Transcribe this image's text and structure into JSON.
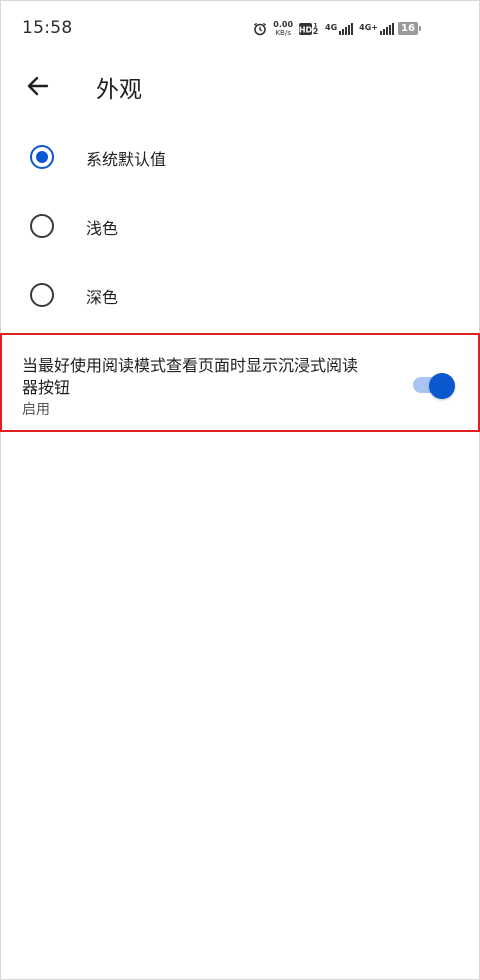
{
  "status_bar": {
    "time": "15:58",
    "net_speed_value": "0.00",
    "net_speed_unit": "KB/s",
    "sim1_label": "4G",
    "sim2_label": "4G+",
    "battery_level": "16",
    "icons": [
      "alarm-icon",
      "hd-icon",
      "signal-icon",
      "battery-icon"
    ]
  },
  "header": {
    "title": "外观"
  },
  "options": [
    {
      "label": "系统默认值",
      "selected": true
    },
    {
      "label": "浅色",
      "selected": false
    },
    {
      "label": "深色",
      "selected": false
    }
  ],
  "immersive_reader": {
    "title": "当最好使用阅读模式查看页面时显示沉浸式阅读器按钮",
    "status": "启用",
    "enabled": true
  },
  "colors": {
    "accent": "#0b57d0",
    "switch_track": "#a8c4f0",
    "highlight_border": "#e02020"
  }
}
